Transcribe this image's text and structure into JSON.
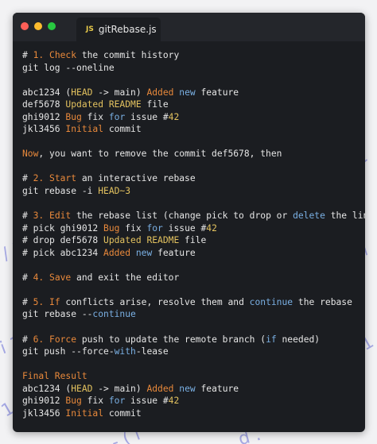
{
  "colors": {
    "text": "#e6e6e6",
    "orange": "#e9893b",
    "yellow": "#e3c25f",
    "blue": "#7ab0e4",
    "window_bg": "#1b1d21",
    "titlebar_bg": "#24262b",
    "close": "#fe5f57",
    "minimize": "#febc2e",
    "maximize": "#28c840"
  },
  "window": {
    "tab_icon": "JS",
    "tab_title": "gitRebase.js"
  },
  "code_lines": [
    [
      {
        "t": "# "
      },
      {
        "t": "1. Check",
        "c": "o"
      },
      {
        "t": " the commit history"
      }
    ],
    [
      {
        "t": "git log --oneline"
      }
    ],
    [],
    [
      {
        "t": "abc1234 ("
      },
      {
        "t": "HEAD",
        "c": "y"
      },
      {
        "t": " -> main) "
      },
      {
        "t": "Added",
        "c": "o"
      },
      {
        "t": " "
      },
      {
        "t": "new",
        "c": "b"
      },
      {
        "t": " feature"
      }
    ],
    [
      {
        "t": "def5678 "
      },
      {
        "t": "Updated README",
        "c": "y"
      },
      {
        "t": " file"
      }
    ],
    [
      {
        "t": "ghi9012 "
      },
      {
        "t": "Bug",
        "c": "o"
      },
      {
        "t": " fix "
      },
      {
        "t": "for",
        "c": "b"
      },
      {
        "t": " issue #"
      },
      {
        "t": "42",
        "c": "y"
      }
    ],
    [
      {
        "t": "jkl3456 "
      },
      {
        "t": "Initial",
        "c": "o"
      },
      {
        "t": " commit"
      }
    ],
    [],
    [
      {
        "t": "Now",
        "c": "o"
      },
      {
        "t": ", you want to remove the commit def5678, then"
      }
    ],
    [],
    [
      {
        "t": "# "
      },
      {
        "t": "2. Start",
        "c": "o"
      },
      {
        "t": " an interactive rebase"
      }
    ],
    [
      {
        "t": "git rebase -i "
      },
      {
        "t": "HEAD~3",
        "c": "y"
      }
    ],
    [],
    [
      {
        "t": "# "
      },
      {
        "t": "3. Edit",
        "c": "o"
      },
      {
        "t": " the rebase list (change pick to drop or "
      },
      {
        "t": "delete",
        "c": "b"
      },
      {
        "t": " the line)"
      }
    ],
    [
      {
        "t": "# pick ghi9012 "
      },
      {
        "t": "Bug",
        "c": "o"
      },
      {
        "t": " fix "
      },
      {
        "t": "for",
        "c": "b"
      },
      {
        "t": " issue #"
      },
      {
        "t": "42",
        "c": "y"
      }
    ],
    [
      {
        "t": "# drop def5678 "
      },
      {
        "t": "Updated README",
        "c": "y"
      },
      {
        "t": " file"
      }
    ],
    [
      {
        "t": "# pick abc1234 "
      },
      {
        "t": "Added",
        "c": "o"
      },
      {
        "t": " "
      },
      {
        "t": "new",
        "c": "b"
      },
      {
        "t": " feature"
      }
    ],
    [],
    [
      {
        "t": "# "
      },
      {
        "t": "4. Save",
        "c": "o"
      },
      {
        "t": " and exit the editor"
      }
    ],
    [],
    [
      {
        "t": "# "
      },
      {
        "t": "5. If",
        "c": "o"
      },
      {
        "t": " conflicts arise, resolve them and "
      },
      {
        "t": "continue",
        "c": "b"
      },
      {
        "t": " the rebase"
      }
    ],
    [
      {
        "t": "git rebase --"
      },
      {
        "t": "continue",
        "c": "b"
      }
    ],
    [],
    [
      {
        "t": "# "
      },
      {
        "t": "6. Force",
        "c": "o"
      },
      {
        "t": " push to update the remote branch ("
      },
      {
        "t": "if",
        "c": "b"
      },
      {
        "t": " needed)"
      }
    ],
    [
      {
        "t": "git push --force-"
      },
      {
        "t": "with",
        "c": "b"
      },
      {
        "t": "-lease"
      }
    ],
    [],
    [
      {
        "t": "Final Result",
        "c": "o"
      }
    ],
    [
      {
        "t": "abc1234 ("
      },
      {
        "t": "HEAD",
        "c": "y"
      },
      {
        "t": " -> main) "
      },
      {
        "t": "Added",
        "c": "o"
      },
      {
        "t": " "
      },
      {
        "t": "new",
        "c": "b"
      },
      {
        "t": " feature"
      }
    ],
    [
      {
        "t": "ghi9012 "
      },
      {
        "t": "Bug",
        "c": "o"
      },
      {
        "t": " fix "
      },
      {
        "t": "for",
        "c": "b"
      },
      {
        "t": " issue #"
      },
      {
        "t": "42",
        "c": "y"
      }
    ],
    [
      {
        "t": "jkl3456 "
      },
      {
        "t": "Initial",
        "c": "o"
      },
      {
        "t": " commit"
      }
    ]
  ]
}
